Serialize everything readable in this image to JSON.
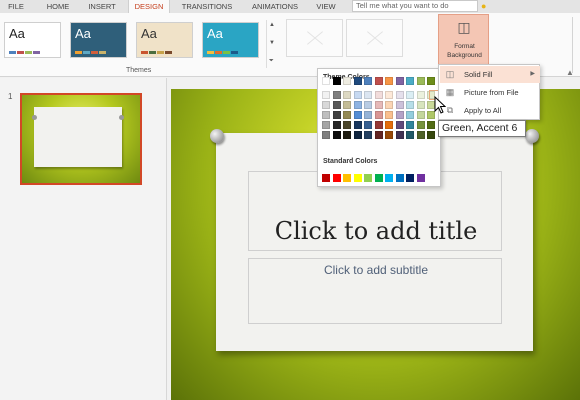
{
  "tabs": [
    {
      "label": "FILE"
    },
    {
      "label": "HOME"
    },
    {
      "label": "INSERT"
    },
    {
      "label": "DESIGN",
      "active": true
    },
    {
      "label": "TRANSITIONS"
    },
    {
      "label": "ANIMATIONS"
    },
    {
      "label": "VIEW"
    }
  ],
  "tell_me": {
    "placeholder": "Tell me what you want to do"
  },
  "ribbon": {
    "themes_label": "Themes",
    "themes": [
      {
        "aa": "Aa",
        "bg": "#ffffff",
        "fg": "#222222",
        "swatches": [
          "#4f81bd",
          "#c0504d",
          "#9bbb59",
          "#8064a2"
        ]
      },
      {
        "aa": "Aa",
        "bg": "#2f5f7a",
        "fg": "#ffffff",
        "swatches": [
          "#f0a030",
          "#5ea8c4",
          "#d35f3c",
          "#c8b26a"
        ]
      },
      {
        "aa": "Aa",
        "bg": "#f0e2c8",
        "fg": "#333333",
        "swatches": [
          "#c9552f",
          "#4b6e3f",
          "#c7a24a",
          "#7a4a2c"
        ]
      },
      {
        "aa": "Aa",
        "bg": "#2aa5c4",
        "fg": "#ffffff",
        "swatches": [
          "#f0c040",
          "#e06c2c",
          "#7ac143",
          "#1a5a8a"
        ]
      }
    ],
    "format_background": {
      "label": "Format Background",
      "icon": "paint-bucket-icon"
    }
  },
  "slide_pane": {
    "slide_number": "1"
  },
  "slide": {
    "title_placeholder": "Click to add title",
    "subtitle_placeholder": "Click to add subtitle"
  },
  "palette": {
    "theme_colors_label": "Theme Colors",
    "standard_colors_label": "Standard Colors",
    "theme_columns": [
      [
        "#ffffff",
        "#f2f2f2",
        "#d9d9d9",
        "#bfbfbf",
        "#a6a6a6",
        "#808080"
      ],
      [
        "#000000",
        "#7f7f7f",
        "#595959",
        "#404040",
        "#262626",
        "#0d0d0d"
      ],
      [
        "#eeece1",
        "#ddd9c3",
        "#c4bd97",
        "#948a54",
        "#4a452a",
        "#1e1c11"
      ],
      [
        "#1f497d",
        "#c6d9f1",
        "#8db3e2",
        "#548dd4",
        "#17365d",
        "#0f243e"
      ],
      [
        "#4f81bd",
        "#dbe5f1",
        "#b8cce4",
        "#95b3d7",
        "#366092",
        "#244061"
      ],
      [
        "#c0504d",
        "#f2dcdb",
        "#e6b9b8",
        "#d99694",
        "#953735",
        "#632523"
      ],
      [
        "#f79646",
        "#fde9d9",
        "#fbd5b5",
        "#fac08f",
        "#e46c0a",
        "#984807"
      ],
      [
        "#8064a2",
        "#e5e0ec",
        "#ccc1da",
        "#b3a2c7",
        "#604a7b",
        "#403152"
      ],
      [
        "#4bacc6",
        "#dbeef4",
        "#b7dee8",
        "#93cddd",
        "#31859c",
        "#215968"
      ],
      [
        "#9bbb59",
        "#ebf1de",
        "#d7e4bd",
        "#c3d69b",
        "#76923c",
        "#4f6128"
      ],
      [
        "#6d8e1a",
        "#e4eccc",
        "#c9d999",
        "#aec666",
        "#516a13",
        "#36470d"
      ]
    ],
    "standard_colors": [
      "#c00000",
      "#ff0000",
      "#ffc000",
      "#ffff00",
      "#92d050",
      "#00b050",
      "#00b0f0",
      "#0070c0",
      "#002060",
      "#7030a0"
    ]
  },
  "bg_menu": {
    "items": [
      {
        "label": "Solid Fill",
        "icon": "paint-bucket-icon",
        "highlighted": true,
        "submenu": true
      },
      {
        "label": "Picture from File",
        "icon": "picture-icon"
      },
      {
        "label": "Apply to All",
        "icon": "apply-all-icon"
      }
    ]
  },
  "tooltip": {
    "text": "Green, Accent 6"
  }
}
